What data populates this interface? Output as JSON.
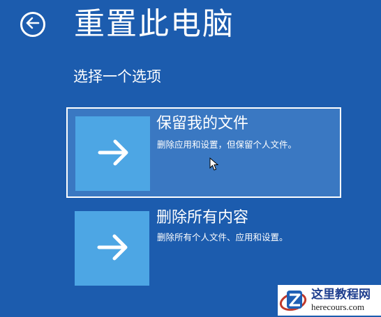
{
  "header": {
    "back_icon": "back-arrow-circle-icon",
    "title": "重置此电脑",
    "subtitle": "选择一个选项"
  },
  "options": [
    {
      "title": "保留我的文件",
      "description": "删除应用和设置，但保留个人文件。",
      "icon": "right-arrow-icon",
      "selected": true
    },
    {
      "title": "删除所有内容",
      "description": "删除所有个人文件、应用和设置。",
      "icon": "right-arrow-icon",
      "selected": false
    }
  ],
  "watermark": {
    "name": "这里教程网",
    "url": "herecours.com"
  },
  "colors": {
    "background": "#1c5cae",
    "tile": "#4da6e4",
    "selected": "#3a78c2"
  }
}
